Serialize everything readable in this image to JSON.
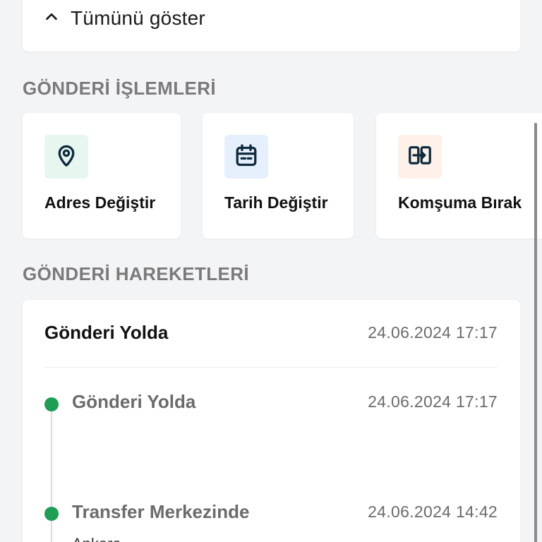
{
  "show_all": {
    "label": "Tümünü göster",
    "icon": "chevron-up-icon"
  },
  "operations": {
    "title": "GÖNDERİ İŞLEMLERİ",
    "items": [
      {
        "label": "Adres Değiştir",
        "icon": "location-pin-icon",
        "icon_color": "#0f2a3d",
        "bg": "#e7f6ef"
      },
      {
        "label": "Tarih Değiştir",
        "icon": "calendar-icon",
        "icon_color": "#0f2a3d",
        "bg": "#e6f0fd"
      },
      {
        "label": "Komşuma Bırak",
        "icon": "neighbor-transfer-icon",
        "icon_color": "#0f2a3d",
        "bg": "#fdf1ea"
      }
    ]
  },
  "movements": {
    "title": "GÖNDERİ HAREKETLERİ",
    "current_status": "Gönderi Yolda",
    "current_date": "24.06.2024 17:17",
    "events": [
      {
        "title": "Gönderi Yolda",
        "date": "24.06.2024 17:17",
        "subtitle": ""
      },
      {
        "title": "Transfer Merkezinde",
        "date": "24.06.2024 14:42",
        "subtitle": "Ankara"
      }
    ]
  },
  "colors": {
    "accent_green": "#1f9d55",
    "icon_dark": "#0f2a3d",
    "section_title": "#7a7a7a",
    "background": "#f3f4f6"
  }
}
